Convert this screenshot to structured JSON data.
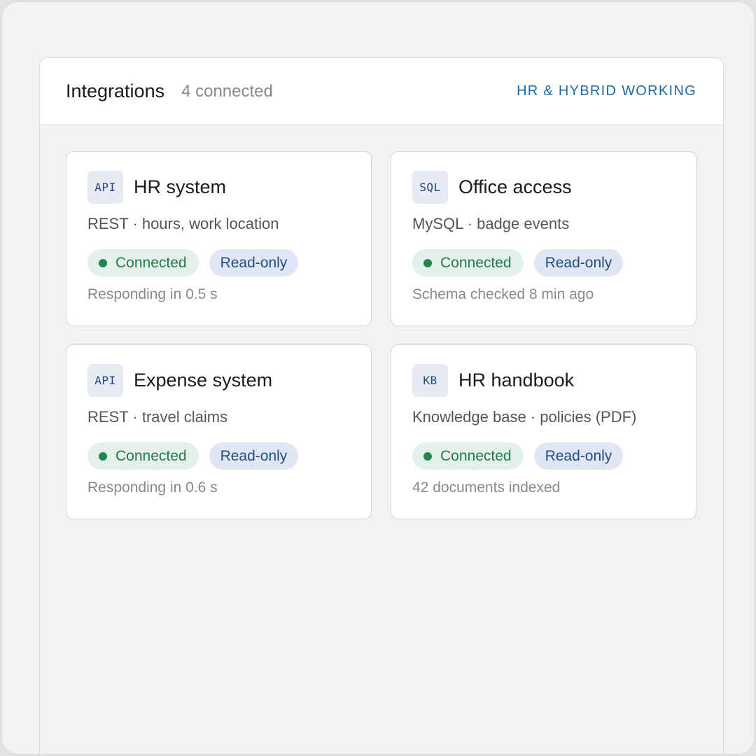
{
  "header": {
    "title": "Integrations",
    "count": "4 connected",
    "context": "HR & HYBRID WORKING"
  },
  "colors": {
    "accent": "#1f6a9e",
    "connected_green": "#22844f",
    "connected_bg": "#e4f1ea",
    "readonly_bg": "#e0e6f3",
    "readonly_text": "#1e4f80"
  },
  "integrations": [
    {
      "type": "API",
      "name": "HR system",
      "description": "REST · hours, work location",
      "status": "Connected",
      "access": "Read-only",
      "meta": "Responding in 0.5 s"
    },
    {
      "type": "SQL",
      "name": "Office access",
      "description": "MySQL · badge events",
      "status": "Connected",
      "access": "Read-only",
      "meta": "Schema checked 8 min ago"
    },
    {
      "type": "API",
      "name": "Expense system",
      "description": "REST · travel claims",
      "status": "Connected",
      "access": "Read-only",
      "meta": "Responding in 0.6 s"
    },
    {
      "type": "KB",
      "name": "HR handbook",
      "description": "Knowledge base · policies (PDF)",
      "status": "Connected",
      "access": "Read-only",
      "meta": "42 documents indexed"
    }
  ]
}
